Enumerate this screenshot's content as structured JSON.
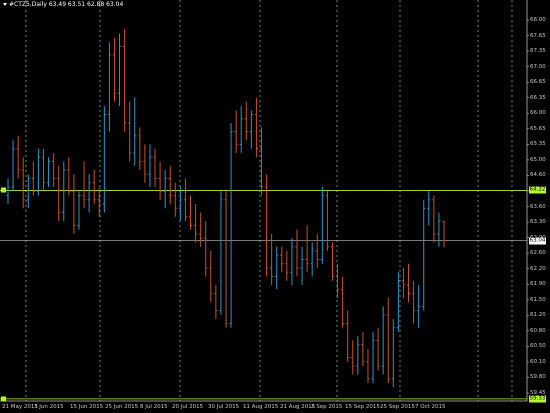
{
  "title": {
    "symbol": "#CTZ5,Daily",
    "ohlc": "63.49 63.51 62.88 63.04"
  },
  "colors": {
    "bull": "#2e96c8",
    "bear": "#c8502a",
    "hline": "#b5f72c",
    "price_line": "#c0c0c0",
    "grid": "#ffffff",
    "axis": "#c0c0c0",
    "bg": "#000000"
  },
  "price_label": "63.04",
  "hlines": [
    {
      "price": 64.22,
      "label": "64.22"
    },
    {
      "price": 59.33,
      "label": "59.33"
    }
  ],
  "chart_data": {
    "type": "ohlc",
    "ylim": [
      59.35,
      68.5
    ],
    "yticks": [
      "68.00",
      "67.65",
      "67.35",
      "67.00",
      "66.65",
      "66.35",
      "66.00",
      "65.65",
      "65.35",
      "65.00",
      "64.60",
      "64.00",
      "63.60",
      "63.30",
      "62.90",
      "62.60",
      "62.20",
      "61.90",
      "61.50",
      "61.20",
      "60.80",
      "60.50",
      "60.10",
      "59.80",
      "59.45"
    ],
    "x_labels": [
      "21 May 2015",
      "3 Jun 2015",
      "15 Jun 2015",
      "25 Jun 2015",
      "8 Jul 2015",
      "20 Jul 2015",
      "30 Jul 2015",
      "11 Aug 2015",
      "21 Aug 2015",
      "2 Sep 2015",
      "15 Sep 2015",
      "25 Sep 2015",
      "7 Oct 2015"
    ],
    "vgrid_dates": [
      "27 May 2015",
      "22 Jun 2015",
      "15 Jul 2015",
      "7 Aug 2015",
      "31 Aug 2015",
      "22 Sep 2015",
      "13 Oct 2015",
      "4 Nov 2015"
    ],
    "candles": [
      {
        "o": 64.1,
        "h": 64.5,
        "l": 63.9,
        "c": 64.3
      },
      {
        "o": 64.3,
        "h": 65.4,
        "l": 64.2,
        "c": 65.2
      },
      {
        "o": 65.2,
        "h": 65.5,
        "l": 64.5,
        "c": 64.7
      },
      {
        "o": 64.7,
        "h": 65.0,
        "l": 63.8,
        "c": 64.0
      },
      {
        "o": 64.0,
        "h": 64.6,
        "l": 63.8,
        "c": 64.5
      },
      {
        "o": 64.5,
        "h": 64.9,
        "l": 64.1,
        "c": 64.2
      },
      {
        "o": 64.2,
        "h": 65.2,
        "l": 64.1,
        "c": 65.0
      },
      {
        "o": 65.0,
        "h": 65.2,
        "l": 64.2,
        "c": 64.4
      },
      {
        "o": 64.4,
        "h": 65.0,
        "l": 64.3,
        "c": 64.9
      },
      {
        "o": 64.9,
        "h": 65.1,
        "l": 64.3,
        "c": 64.5
      },
      {
        "o": 64.5,
        "h": 64.8,
        "l": 63.5,
        "c": 63.7
      },
      {
        "o": 63.7,
        "h": 64.9,
        "l": 63.5,
        "c": 64.7
      },
      {
        "o": 64.7,
        "h": 65.0,
        "l": 64.1,
        "c": 64.2
      },
      {
        "o": 64.2,
        "h": 64.6,
        "l": 63.2,
        "c": 63.4
      },
      {
        "o": 63.4,
        "h": 64.2,
        "l": 63.3,
        "c": 64.1
      },
      {
        "o": 64.1,
        "h": 64.9,
        "l": 63.8,
        "c": 64.0
      },
      {
        "o": 64.0,
        "h": 64.6,
        "l": 63.7,
        "c": 64.4
      },
      {
        "o": 64.4,
        "h": 64.7,
        "l": 63.9,
        "c": 64.0
      },
      {
        "o": 64.0,
        "h": 64.3,
        "l": 63.6,
        "c": 63.9
      },
      {
        "o": 63.9,
        "h": 66.2,
        "l": 63.7,
        "c": 66.0
      },
      {
        "o": 66.0,
        "h": 67.7,
        "l": 65.6,
        "c": 67.4
      },
      {
        "o": 67.4,
        "h": 67.8,
        "l": 66.3,
        "c": 66.5
      },
      {
        "o": 66.5,
        "h": 67.9,
        "l": 66.2,
        "c": 67.6
      },
      {
        "o": 67.6,
        "h": 68.0,
        "l": 65.6,
        "c": 65.8
      },
      {
        "o": 65.8,
        "h": 66.3,
        "l": 64.9,
        "c": 65.1
      },
      {
        "o": 65.1,
        "h": 66.4,
        "l": 64.8,
        "c": 65.5
      },
      {
        "o": 65.5,
        "h": 65.7,
        "l": 64.7,
        "c": 64.9
      },
      {
        "o": 64.9,
        "h": 65.3,
        "l": 64.4,
        "c": 64.6
      },
      {
        "o": 64.6,
        "h": 65.3,
        "l": 64.3,
        "c": 65.0
      },
      {
        "o": 65.0,
        "h": 65.2,
        "l": 64.3,
        "c": 64.5
      },
      {
        "o": 64.5,
        "h": 64.9,
        "l": 64.0,
        "c": 64.2
      },
      {
        "o": 64.2,
        "h": 64.7,
        "l": 63.8,
        "c": 64.5
      },
      {
        "o": 64.5,
        "h": 64.8,
        "l": 63.9,
        "c": 64.1
      },
      {
        "o": 64.1,
        "h": 64.4,
        "l": 63.6,
        "c": 63.8
      },
      {
        "o": 63.8,
        "h": 64.3,
        "l": 63.5,
        "c": 64.0
      },
      {
        "o": 64.0,
        "h": 64.5,
        "l": 63.5,
        "c": 63.6
      },
      {
        "o": 63.6,
        "h": 64.1,
        "l": 63.3,
        "c": 63.4
      },
      {
        "o": 63.4,
        "h": 63.9,
        "l": 63.0,
        "c": 63.2
      },
      {
        "o": 63.2,
        "h": 63.7,
        "l": 62.9,
        "c": 63.1
      },
      {
        "o": 63.1,
        "h": 63.5,
        "l": 62.2,
        "c": 62.4
      },
      {
        "o": 62.4,
        "h": 62.8,
        "l": 61.6,
        "c": 61.8
      },
      {
        "o": 61.8,
        "h": 62.0,
        "l": 61.2,
        "c": 61.4
      },
      {
        "o": 61.4,
        "h": 64.2,
        "l": 61.3,
        "c": 64.0
      },
      {
        "o": 64.0,
        "h": 64.2,
        "l": 61.0,
        "c": 61.1
      },
      {
        "o": 61.1,
        "h": 65.8,
        "l": 61.0,
        "c": 65.6
      },
      {
        "o": 65.6,
        "h": 66.1,
        "l": 65.1,
        "c": 65.3
      },
      {
        "o": 65.3,
        "h": 66.2,
        "l": 65.1,
        "c": 65.9
      },
      {
        "o": 65.9,
        "h": 66.3,
        "l": 65.4,
        "c": 65.6
      },
      {
        "o": 65.6,
        "h": 66.1,
        "l": 65.2,
        "c": 66.0
      },
      {
        "o": 66.0,
        "h": 66.4,
        "l": 65.0,
        "c": 65.2
      },
      {
        "o": 65.2,
        "h": 65.7,
        "l": 64.1,
        "c": 64.3
      },
      {
        "o": 64.3,
        "h": 64.6,
        "l": 62.2,
        "c": 62.4
      },
      {
        "o": 62.4,
        "h": 63.2,
        "l": 62.0,
        "c": 62.2
      },
      {
        "o": 62.2,
        "h": 62.9,
        "l": 61.9,
        "c": 62.7
      },
      {
        "o": 62.7,
        "h": 62.9,
        "l": 62.3,
        "c": 62.5
      },
      {
        "o": 62.5,
        "h": 62.8,
        "l": 62.1,
        "c": 62.3
      },
      {
        "o": 62.3,
        "h": 63.1,
        "l": 62.0,
        "c": 62.9
      },
      {
        "o": 62.9,
        "h": 63.3,
        "l": 62.2,
        "c": 62.4
      },
      {
        "o": 62.4,
        "h": 62.9,
        "l": 62.0,
        "c": 62.6
      },
      {
        "o": 62.6,
        "h": 63.4,
        "l": 62.3,
        "c": 62.5
      },
      {
        "o": 62.5,
        "h": 63.0,
        "l": 62.2,
        "c": 62.8
      },
      {
        "o": 62.8,
        "h": 63.2,
        "l": 62.4,
        "c": 62.6
      },
      {
        "o": 62.6,
        "h": 64.3,
        "l": 62.5,
        "c": 64.1
      },
      {
        "o": 64.1,
        "h": 64.2,
        "l": 62.8,
        "c": 62.9
      },
      {
        "o": 62.9,
        "h": 63.0,
        "l": 62.1,
        "c": 62.2
      },
      {
        "o": 62.2,
        "h": 62.5,
        "l": 61.7,
        "c": 61.9
      },
      {
        "o": 61.9,
        "h": 62.2,
        "l": 61.0,
        "c": 61.1
      },
      {
        "o": 61.1,
        "h": 61.4,
        "l": 60.2,
        "c": 60.3
      },
      {
        "o": 60.3,
        "h": 60.7,
        "l": 59.9,
        "c": 60.1
      },
      {
        "o": 60.1,
        "h": 60.8,
        "l": 59.9,
        "c": 60.6
      },
      {
        "o": 60.6,
        "h": 60.9,
        "l": 60.1,
        "c": 60.2
      },
      {
        "o": 60.2,
        "h": 60.5,
        "l": 59.7,
        "c": 59.8
      },
      {
        "o": 59.8,
        "h": 60.9,
        "l": 59.7,
        "c": 60.7
      },
      {
        "o": 60.7,
        "h": 61.0,
        "l": 60.0,
        "c": 60.1
      },
      {
        "o": 60.1,
        "h": 61.5,
        "l": 59.9,
        "c": 61.3
      },
      {
        "o": 61.3,
        "h": 61.7,
        "l": 59.7,
        "c": 59.8
      },
      {
        "o": 59.8,
        "h": 61.2,
        "l": 59.6,
        "c": 61.0
      },
      {
        "o": 61.0,
        "h": 62.3,
        "l": 60.9,
        "c": 62.1
      },
      {
        "o": 62.1,
        "h": 62.4,
        "l": 61.7,
        "c": 62.0
      },
      {
        "o": 62.0,
        "h": 62.5,
        "l": 61.6,
        "c": 61.8
      },
      {
        "o": 61.8,
        "h": 62.1,
        "l": 61.1,
        "c": 61.4
      },
      {
        "o": 61.4,
        "h": 62.0,
        "l": 61.0,
        "c": 61.5
      },
      {
        "o": 61.5,
        "h": 64.0,
        "l": 61.4,
        "c": 63.8
      },
      {
        "o": 63.8,
        "h": 64.2,
        "l": 63.4,
        "c": 64.0
      },
      {
        "o": 64.0,
        "h": 64.1,
        "l": 63.0,
        "c": 63.2
      },
      {
        "o": 63.2,
        "h": 63.7,
        "l": 62.9,
        "c": 63.5
      },
      {
        "o": 63.49,
        "h": 63.51,
        "l": 62.88,
        "c": 63.04
      }
    ]
  }
}
